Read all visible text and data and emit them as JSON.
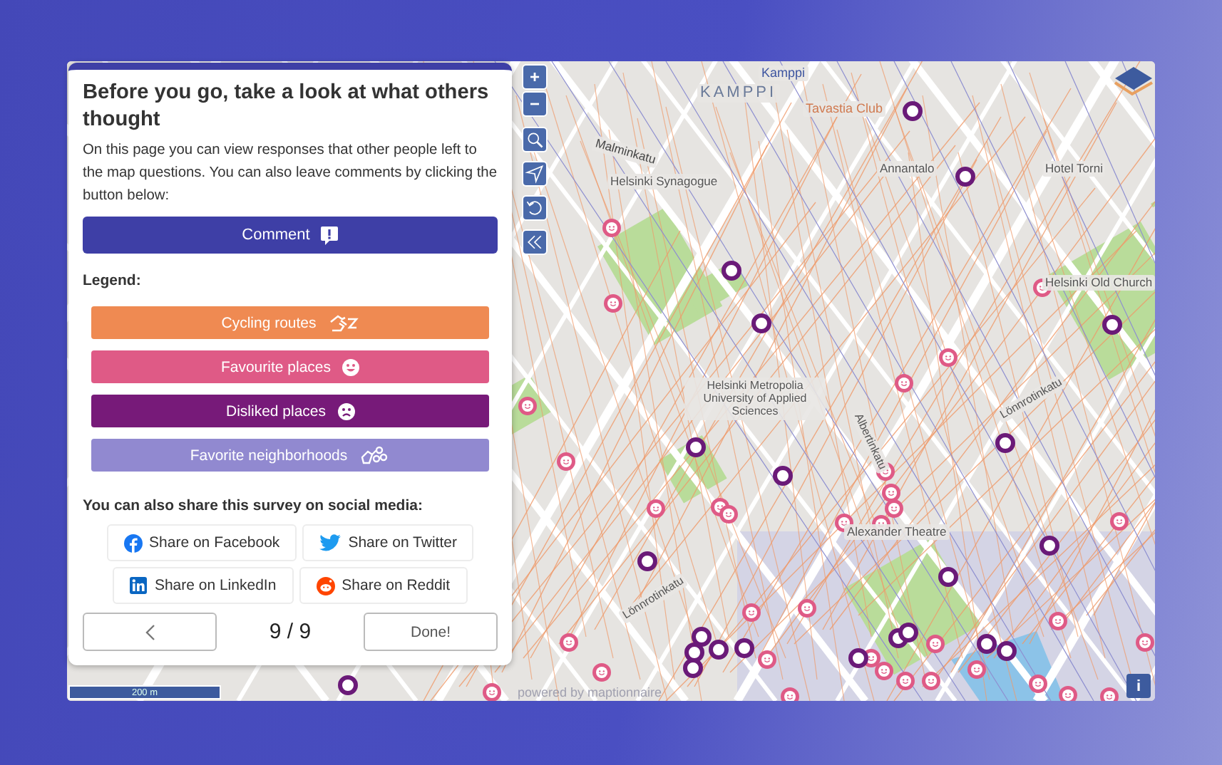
{
  "panel": {
    "title": "Before you go, take a look at what others thought",
    "description": "On this page you can view responses that other people left to the map questions. You can also leave comments by clicking the button below:",
    "comment_button": "Comment",
    "legend_title": "Legend:",
    "legend": [
      {
        "label": "Cycling routes",
        "kind": "cycling",
        "color": "#ef8a52"
      },
      {
        "label": "Favourite places",
        "kind": "favourite",
        "color": "#df5a86"
      },
      {
        "label": "Disliked places",
        "kind": "disliked",
        "color": "#771a79"
      },
      {
        "label": "Favorite neighborhoods",
        "kind": "neighborhood",
        "color": "#9189d0"
      }
    ],
    "share_title": "You can also share this survey on social media:",
    "share_buttons": [
      {
        "label": "Share on Facebook",
        "kind": "facebook"
      },
      {
        "label": "Share on Twitter",
        "kind": "twitter"
      },
      {
        "label": "Share on LinkedIn",
        "kind": "linkedin"
      },
      {
        "label": "Share on Reddit",
        "kind": "reddit"
      }
    ],
    "pager": "9 / 9",
    "done_button": "Done!"
  },
  "map": {
    "zoom_in": "+",
    "zoom_out": "−",
    "labels": [
      {
        "text": "Kamppi",
        "kind": "district"
      },
      {
        "text": "KAMPPI",
        "kind": "area"
      },
      {
        "text": "Tavastia Club",
        "kind": "venue"
      },
      {
        "text": "Malminkatu",
        "kind": "street"
      },
      {
        "text": "Helsinki Synagogue",
        "kind": "place"
      },
      {
        "text": "Annantalo",
        "kind": "place"
      },
      {
        "text": "Hotel Torni",
        "kind": "place"
      },
      {
        "text": "Helsinki Old Church",
        "kind": "place"
      },
      {
        "text": "Helsinki Metropolia University of Applied Sciences",
        "kind": "place"
      },
      {
        "text": "Albertinkatu",
        "kind": "street"
      },
      {
        "text": "Lönnrotinkatu",
        "kind": "street"
      },
      {
        "text": "Alexander Theatre",
        "kind": "place"
      },
      {
        "text": "Lönnrotinkatu",
        "kind": "street"
      }
    ],
    "scale": "200 m",
    "attribution": "powered by maptionnaire",
    "info": "i"
  }
}
